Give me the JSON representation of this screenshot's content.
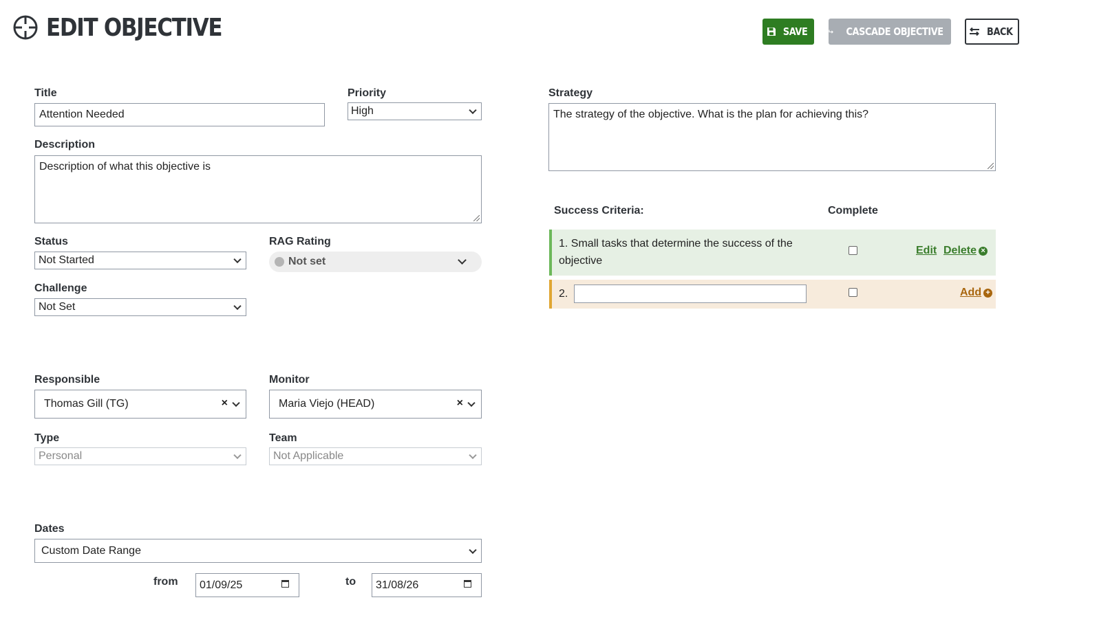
{
  "header": {
    "title": "EDIT OBJECTIVE",
    "title_icon": "crosshair-icon",
    "save_label": "SAVE",
    "cascade_label": "CASCADE OBJECTIVE",
    "back_label": "BACK"
  },
  "form": {
    "title_label": "Title",
    "title_value": "Attention Needed",
    "priority_label": "Priority",
    "priority_value": "High",
    "description_label": "Description",
    "description_value": "Description of what this objective is",
    "status_label": "Status",
    "status_value": "Not Started",
    "rag_label": "RAG Rating",
    "rag_value": "Not set",
    "challenge_label": "Challenge",
    "challenge_value": "Not Set",
    "responsible_label": "Responsible",
    "responsible_value": "Thomas Gill (TG)",
    "monitor_label": "Monitor",
    "monitor_value": "Maria Viejo (HEAD)",
    "clear_symbol": "×",
    "type_label": "Type",
    "type_value": "Personal",
    "team_label": "Team",
    "team_value": "Not Applicable",
    "dates_label": "Dates",
    "dates_value": "Custom Date Range",
    "from_label": "from",
    "from_value": "01/09/25",
    "to_label": "to",
    "to_value": "31/08/26"
  },
  "strategy": {
    "label": "Strategy",
    "value": "The strategy of the objective. What is the plan for achieving this?"
  },
  "criteria": {
    "header_label": "Success Criteria:",
    "complete_label": "Complete",
    "items": [
      {
        "text": "1. Small tasks that determine the success of the objective",
        "complete": false,
        "edit_label": "Edit",
        "delete_label": "Delete"
      }
    ],
    "new_item": {
      "number": "2.",
      "value": "",
      "complete": false,
      "add_label": "Add"
    }
  },
  "colors": {
    "save": "#2e7d22",
    "cascade": "#a8adb3",
    "criteria_done_bg": "#e6f0e4",
    "criteria_done_bar": "#6cb85a",
    "criteria_new_bg": "#f7ebdc",
    "criteria_new_bar": "#e0a632"
  }
}
